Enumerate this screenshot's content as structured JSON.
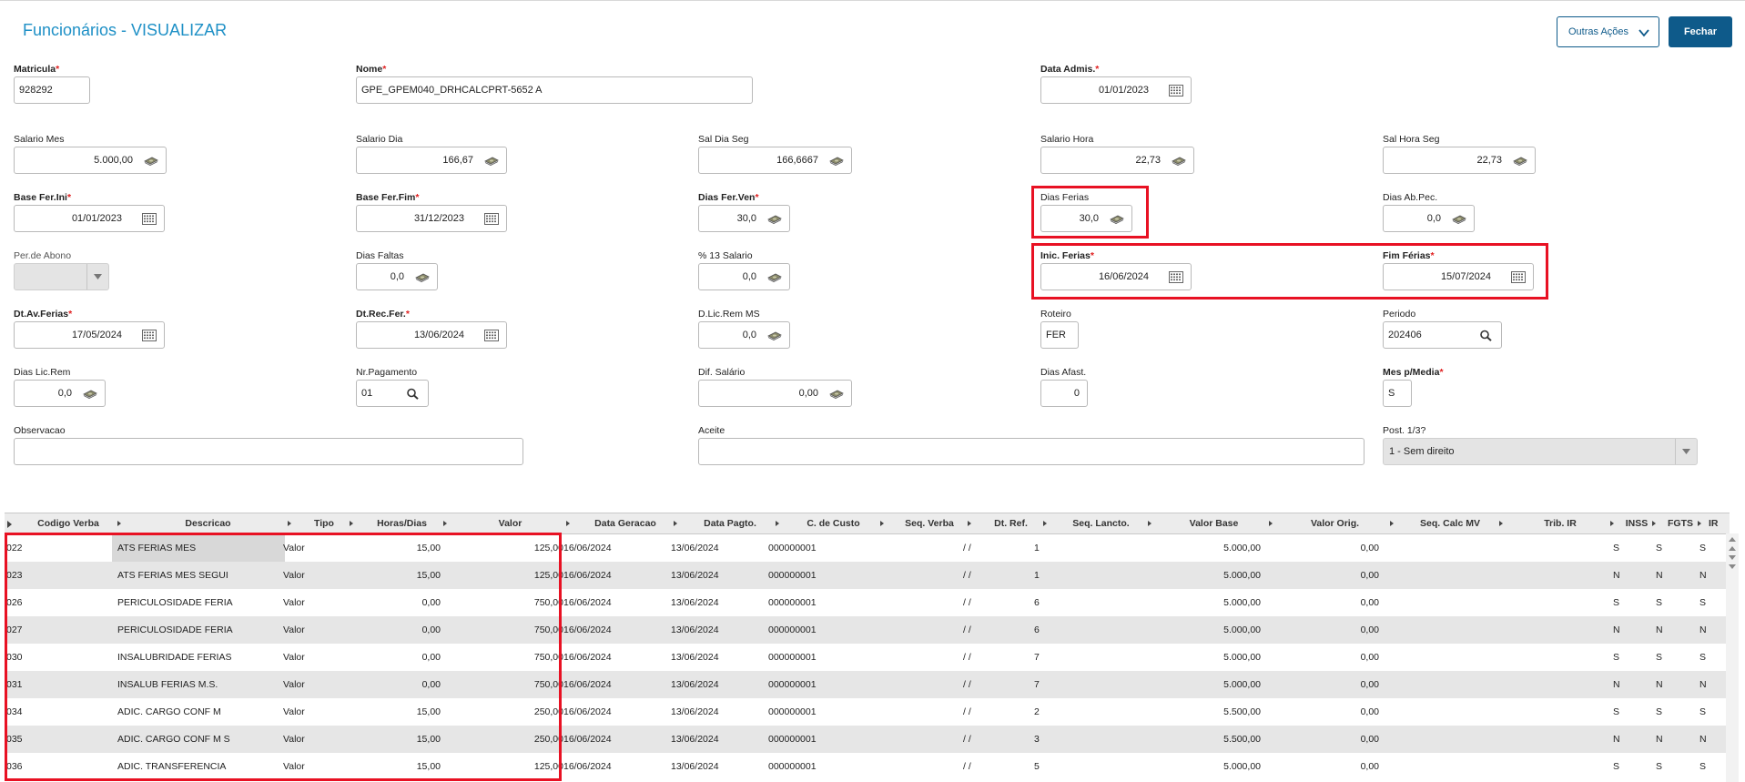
{
  "header": {
    "title": "Funcionários - VISUALIZAR",
    "outras_acoes_label": "Outras Ações",
    "fechar_label": "Fechar"
  },
  "form": {
    "matricula": {
      "label": "Matricula",
      "value": "928292"
    },
    "nome": {
      "label": "Nome",
      "value": "GPE_GPEM040_DRHCALCPRT-5652 A"
    },
    "data_admis": {
      "label": "Data Admis.",
      "value": "01/01/2023"
    },
    "salario_mes": {
      "label": "Salario Mes",
      "value": "5.000,00"
    },
    "salario_dia": {
      "label": "Salario Dia",
      "value": "166,67"
    },
    "sal_dia_seg": {
      "label": "Sal Dia Seg",
      "value": "166,6667"
    },
    "salario_hora": {
      "label": "Salario Hora",
      "value": "22,73"
    },
    "sal_hora_seg": {
      "label": "Sal Hora Seg",
      "value": "22,73"
    },
    "base_fer_ini": {
      "label": "Base Fer.Ini",
      "value": "01/01/2023"
    },
    "base_fer_fim": {
      "label": "Base Fer.Fim",
      "value": "31/12/2023"
    },
    "dias_fer_ven": {
      "label": "Dias Fer.Ven",
      "value": "30,0"
    },
    "dias_ferias": {
      "label": "Dias Ferias",
      "value": "30,0"
    },
    "dias_ab_pec": {
      "label": "Dias Ab.Pec.",
      "value": "0,0"
    },
    "per_de_abono": {
      "label": "Per.de Abono",
      "value": ""
    },
    "dias_faltas": {
      "label": "Dias Faltas",
      "value": "0,0"
    },
    "pct_13_salario": {
      "label": "% 13 Salario",
      "value": "0,0"
    },
    "inic_ferias": {
      "label": "Inic. Ferias",
      "value": "16/06/2024"
    },
    "fim_ferias": {
      "label": "Fim Férias",
      "value": "15/07/2024"
    },
    "dt_av_ferias": {
      "label": "Dt.Av.Ferias",
      "value": "17/05/2024"
    },
    "dt_rec_fer": {
      "label": "Dt.Rec.Fer.",
      "value": "13/06/2024"
    },
    "d_lic_rem_ms": {
      "label": "D.Lic.Rem MS",
      "value": "0,0"
    },
    "roteiro": {
      "label": "Roteiro",
      "value": "FER"
    },
    "periodo": {
      "label": "Periodo",
      "value": "202406"
    },
    "dias_lic_rem": {
      "label": "Dias Lic.Rem",
      "value": "0,0"
    },
    "nr_pagamento": {
      "label": "Nr.Pagamento",
      "value": "01"
    },
    "dif_salario": {
      "label": "Dif. Salário",
      "value": "0,00"
    },
    "dias_afast": {
      "label": "Dias Afast.",
      "value": "0"
    },
    "mes_p_media": {
      "label": "Mes p/Media",
      "value": "S"
    },
    "observacao": {
      "label": "Observacao",
      "value": ""
    },
    "aceite": {
      "label": "Aceite",
      "value": ""
    },
    "post_1_3": {
      "label": "Post. 1/3?",
      "value": "1 - Sem direito"
    },
    "required_mark": "*"
  },
  "grid": {
    "columns": [
      "Codigo Verba",
      "Descricao",
      "Tipo",
      "Horas/Dias",
      "Valor",
      "Data Geracao",
      "Data Pagto.",
      "C. de Custo",
      "Seq. Verba",
      "Dt. Ref.",
      "Seq. Lancto.",
      "Valor Base",
      "Valor Orig.",
      "Seq. Calc MV",
      "Trib. IR",
      "INSS",
      "FGTS",
      "IR"
    ],
    "rows": [
      {
        "codigo": "022",
        "descricao": "ATS FERIAS MES",
        "tipo": "Valor",
        "horas": "15,00",
        "valor": "125,00",
        "data_geracao": "16/06/2024",
        "data_pagto": "13/06/2024",
        "custo": "000000001",
        "dt_ref": "/ /",
        "seq_lancto": "1",
        "valor_base": "5.000,00",
        "valor_orig": "0,00",
        "inss": "S",
        "fgts": "S",
        "ir": "S"
      },
      {
        "codigo": "023",
        "descricao": "ATS FERIAS MES SEGUI",
        "tipo": "Valor",
        "horas": "15,00",
        "valor": "125,00",
        "data_geracao": "16/06/2024",
        "data_pagto": "13/06/2024",
        "custo": "000000001",
        "dt_ref": "/ /",
        "seq_lancto": "1",
        "valor_base": "5.000,00",
        "valor_orig": "0,00",
        "inss": "N",
        "fgts": "N",
        "ir": "N"
      },
      {
        "codigo": "026",
        "descricao": "PERICULOSIDADE FERIA",
        "tipo": "Valor",
        "horas": "0,00",
        "valor": "750,00",
        "data_geracao": "16/06/2024",
        "data_pagto": "13/06/2024",
        "custo": "000000001",
        "dt_ref": "/ /",
        "seq_lancto": "6",
        "valor_base": "5.000,00",
        "valor_orig": "0,00",
        "inss": "S",
        "fgts": "S",
        "ir": "S"
      },
      {
        "codigo": "027",
        "descricao": "PERICULOSIDADE FERIA",
        "tipo": "Valor",
        "horas": "0,00",
        "valor": "750,00",
        "data_geracao": "16/06/2024",
        "data_pagto": "13/06/2024",
        "custo": "000000001",
        "dt_ref": "/ /",
        "seq_lancto": "6",
        "valor_base": "5.000,00",
        "valor_orig": "0,00",
        "inss": "N",
        "fgts": "N",
        "ir": "N"
      },
      {
        "codigo": "030",
        "descricao": "INSALUBRIDADE FERIAS",
        "tipo": "Valor",
        "horas": "0,00",
        "valor": "750,00",
        "data_geracao": "16/06/2024",
        "data_pagto": "13/06/2024",
        "custo": "000000001",
        "dt_ref": "/ /",
        "seq_lancto": "7",
        "valor_base": "5.000,00",
        "valor_orig": "0,00",
        "inss": "S",
        "fgts": "S",
        "ir": "S"
      },
      {
        "codigo": "031",
        "descricao": "INSALUB FERIAS M.S.",
        "tipo": "Valor",
        "horas": "0,00",
        "valor": "750,00",
        "data_geracao": "16/06/2024",
        "data_pagto": "13/06/2024",
        "custo": "000000001",
        "dt_ref": "/ /",
        "seq_lancto": "7",
        "valor_base": "5.000,00",
        "valor_orig": "0,00",
        "inss": "N",
        "fgts": "N",
        "ir": "N"
      },
      {
        "codigo": "034",
        "descricao": "ADIC. CARGO CONF M",
        "tipo": "Valor",
        "horas": "15,00",
        "valor": "250,00",
        "data_geracao": "16/06/2024",
        "data_pagto": "13/06/2024",
        "custo": "000000001",
        "dt_ref": "/ /",
        "seq_lancto": "2",
        "valor_base": "5.500,00",
        "valor_orig": "0,00",
        "inss": "S",
        "fgts": "S",
        "ir": "S"
      },
      {
        "codigo": "035",
        "descricao": "ADIC. CARGO CONF M S",
        "tipo": "Valor",
        "horas": "15,00",
        "valor": "250,00",
        "data_geracao": "16/06/2024",
        "data_pagto": "13/06/2024",
        "custo": "000000001",
        "dt_ref": "/ /",
        "seq_lancto": "3",
        "valor_base": "5.500,00",
        "valor_orig": "0,00",
        "inss": "N",
        "fgts": "N",
        "ir": "N"
      },
      {
        "codigo": "036",
        "descricao": "ADIC. TRANSFERENCIA",
        "tipo": "Valor",
        "horas": "15,00",
        "valor": "125,00",
        "data_geracao": "16/06/2024",
        "data_pagto": "13/06/2024",
        "custo": "000000001",
        "dt_ref": "/ /",
        "seq_lancto": "5",
        "valor_base": "5.000,00",
        "valor_orig": "0,00",
        "inss": "S",
        "fgts": "S",
        "ir": "S"
      }
    ]
  },
  "colors": {
    "accent": "#0e5a8a",
    "title": "#1e90c6",
    "highlight": "#e81123"
  },
  "icons": {
    "calendar": "calendar-icon",
    "money": "money-icon",
    "search": "search-icon",
    "dropdown": "chevron-down-icon"
  }
}
